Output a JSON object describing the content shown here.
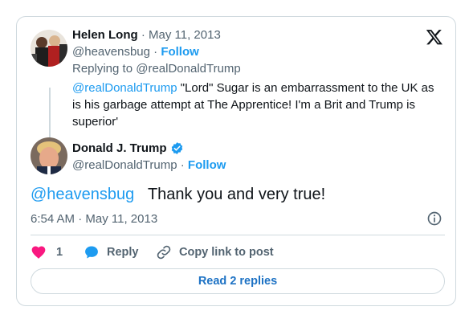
{
  "quoted": {
    "name": "Helen Long",
    "dot": "·",
    "date": "May 11, 2013",
    "handle": "@heavensbug",
    "follow": "Follow",
    "replying_prefix": "Replying to ",
    "replying_handle": "@realDonaldTrump",
    "mention": "@realDonaldTrump",
    "text": " \"Lord\" Sugar is an embarrassment to the UK as is his garbage attempt at The Apprentice!   I'm a Brit and Trump is superior'"
  },
  "main": {
    "name": "Donald J. Trump",
    "handle": "@realDonaldTrump",
    "dot": "·",
    "follow": "Follow",
    "mention": "@heavensbug",
    "text": "Thank you and very true!",
    "time": "6:54 AM",
    "date": "May 11, 2013"
  },
  "actions": {
    "like_count": "1",
    "reply_label": "Reply",
    "copy_label": "Copy link to post"
  },
  "read_replies": "Read 2 replies",
  "icons": {
    "x_logo": "x-logo-icon",
    "verified": "verified-badge-icon",
    "info": "info-icon",
    "heart": "heart-icon",
    "reply": "reply-bubble-icon",
    "link": "link-icon"
  },
  "colors": {
    "accent": "#1d9bf0",
    "like": "#f91880",
    "muted": "#536471",
    "border": "#cfd9de"
  }
}
